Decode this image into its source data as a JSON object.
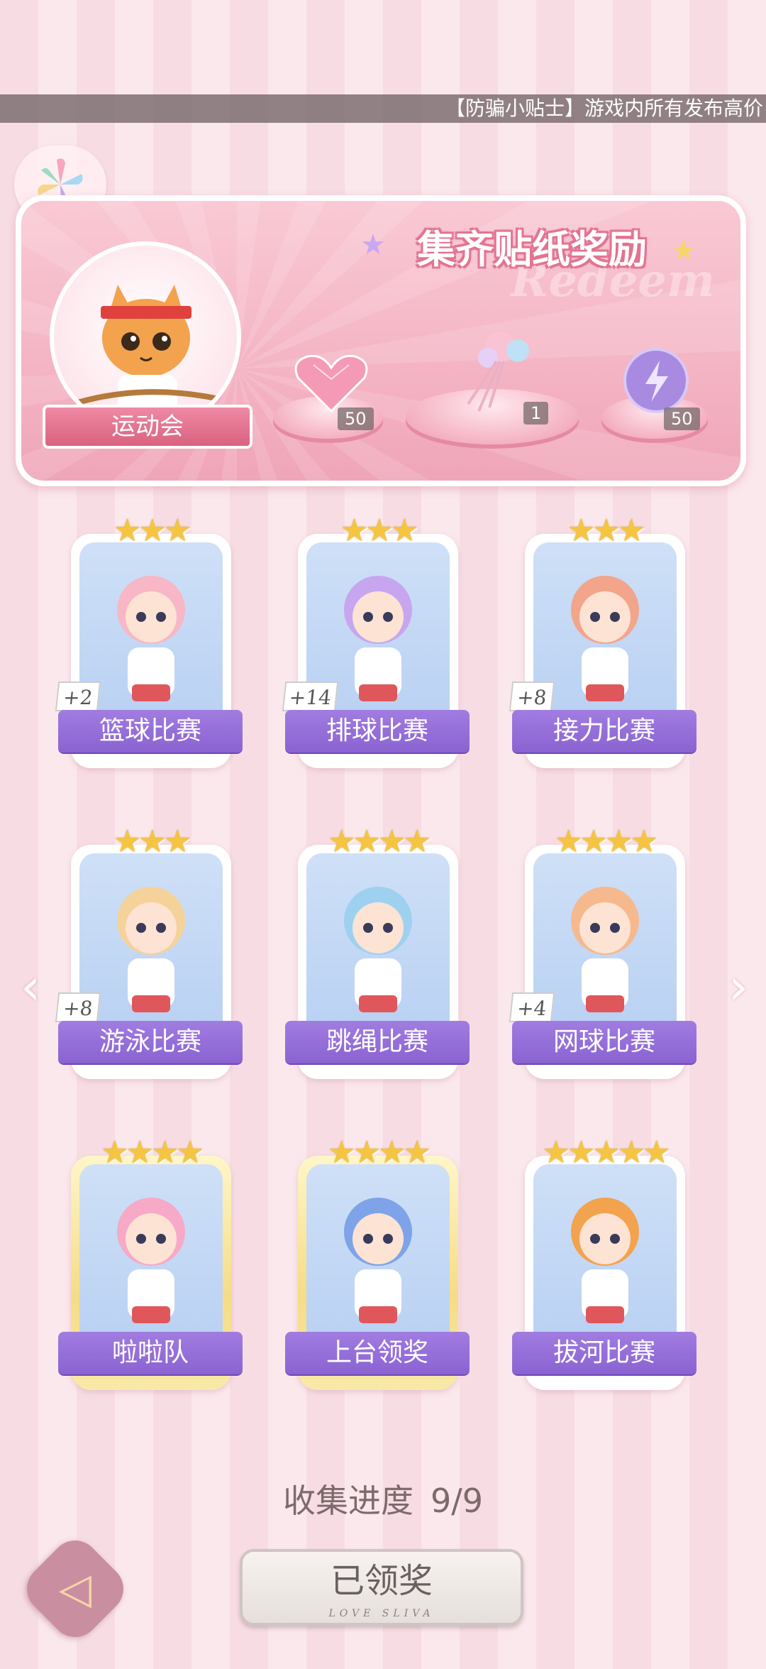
{
  "ticker_text": "【防骗小贴士】游戏内所有发布高价",
  "banner": {
    "title": "集齐贴纸奖励",
    "watermark": "Redeem",
    "event_label": "运动会",
    "rewards": [
      {
        "icon": "heart-gem-icon",
        "count": "50"
      },
      {
        "icon": "flower-bouquet-icon",
        "count": "1"
      },
      {
        "icon": "lightning-orb-icon",
        "count": "50"
      }
    ]
  },
  "cards": [
    {
      "label": "篮球比赛",
      "bonus": "+2",
      "stars": "★★★",
      "icon": "basketball-girl-art",
      "gold": false
    },
    {
      "label": "排球比赛",
      "bonus": "+14",
      "stars": "★★★",
      "icon": "volleyball-girl-art",
      "gold": false
    },
    {
      "label": "接力比赛",
      "bonus": "+8",
      "stars": "★★★",
      "icon": "relay-girl-art",
      "gold": false
    },
    {
      "label": "游泳比赛",
      "bonus": "+8",
      "stars": "★★★",
      "icon": "swimming-dog-art",
      "gold": false
    },
    {
      "label": "跳绳比赛",
      "bonus": "",
      "stars": "★★★★",
      "icon": "jump-rope-girl-art",
      "gold": false
    },
    {
      "label": "网球比赛",
      "bonus": "+4",
      "stars": "★★★★",
      "icon": "tennis-girl-art",
      "gold": false
    },
    {
      "label": "啦啦队",
      "bonus": "",
      "stars": "★★★★",
      "icon": "cheerleader-girl-art",
      "gold": true
    },
    {
      "label": "上台领奖",
      "bonus": "",
      "stars": "★★★★",
      "icon": "trophy-girl-art",
      "gold": true
    },
    {
      "label": "拔河比赛",
      "bonus": "",
      "stars": "★★★★★",
      "icon": "tug-of-war-cat-art",
      "gold": false
    }
  ],
  "progress": {
    "label": "收集进度",
    "value": "9/9",
    "collected": 9,
    "total": 9
  },
  "claim_button": {
    "label": "已领奖",
    "subtext": "LOVE SLIVA"
  },
  "nav": {
    "left": "‹",
    "right": "›"
  },
  "back_icon": "◁"
}
